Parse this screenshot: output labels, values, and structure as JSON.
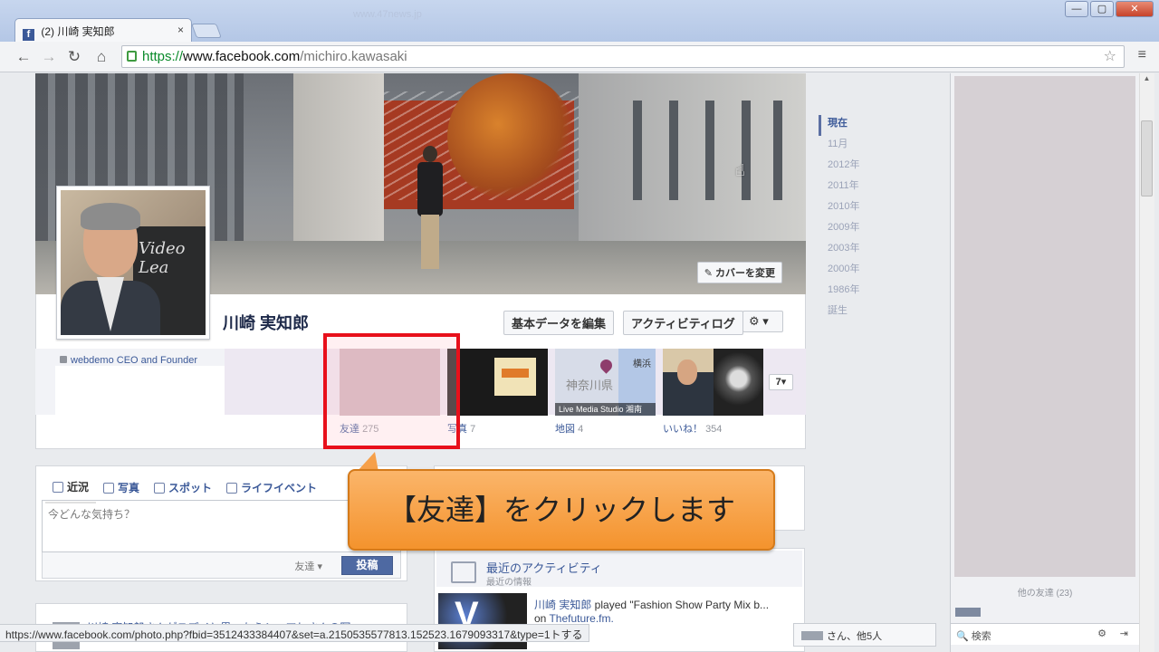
{
  "browser": {
    "tab_title": "(2) 川崎 実知郎",
    "tab_favicon": "f",
    "tab_close": "×",
    "ghost_text": "www.47news.jp",
    "win_min": "—",
    "win_max": "▢",
    "win_close": "✕",
    "nav_back": "←",
    "nav_forward": "→",
    "nav_reload": "↻",
    "nav_home": "⌂",
    "url_scheme": "https://",
    "url_host": "www.facebook.com",
    "url_path": "/michiro.kawasaki",
    "star": "☆",
    "menu": "≡"
  },
  "cover": {
    "change_cover_label": "✎ カバーを変更"
  },
  "profile": {
    "name": "川崎 実知郎",
    "pic_board_text": "Video Lea",
    "edit_button": "基本データを編集",
    "activity_log_button": "アクティビティログ",
    "gear_button": "⚙ ▾",
    "work": "webdemo CEO and Founder"
  },
  "apps": [
    {
      "label": "友達",
      "count": "275"
    },
    {
      "label": "写真",
      "count": "7"
    },
    {
      "label": "地図",
      "count": "4"
    },
    {
      "label": "いいね！",
      "count": "354"
    }
  ],
  "map_thumb": {
    "label_top": "横浜",
    "label_mid": "神奈川県",
    "caption": "Live Media Studio 湘南"
  },
  "more_button": "7▾",
  "timeline": [
    "現在",
    "11月",
    "2012年",
    "2011年",
    "2010年",
    "2009年",
    "2003年",
    "2000年",
    "1986年",
    "誕生"
  ],
  "composer": {
    "tabs": [
      "近況",
      "写真",
      "スポット",
      "ライフイベント"
    ],
    "placeholder": "今どんな気持ち？",
    "audience": "友達 ▾",
    "post_button": "投稿"
  },
  "activity": {
    "title": "最近のアクティビティ",
    "subtitle": "最近の情報",
    "line1_name": "川崎 実知郎",
    "line1_rest": " played \"Fashion Show Party Mix b...",
    "line2_on": "on ",
    "line2_link": "Thefuture.fm."
  },
  "story": {
    "text": "川崎 実知郎さんがスプイと思ったらシェアしさんの写"
  },
  "callout": "【友達】をクリックします",
  "right_column": {
    "friends_online": "他の友達 (23)",
    "search": "🔍 検索",
    "gear": "⚙",
    "popout": "⇥"
  },
  "statusbar": "https://www.facebook.com/photo.php?fbid=3512433384407&set=a.2150535577813.152523.1679093317&type=1",
  "statusbar_tail": "トする",
  "chat_tab": "さん、他5人"
}
